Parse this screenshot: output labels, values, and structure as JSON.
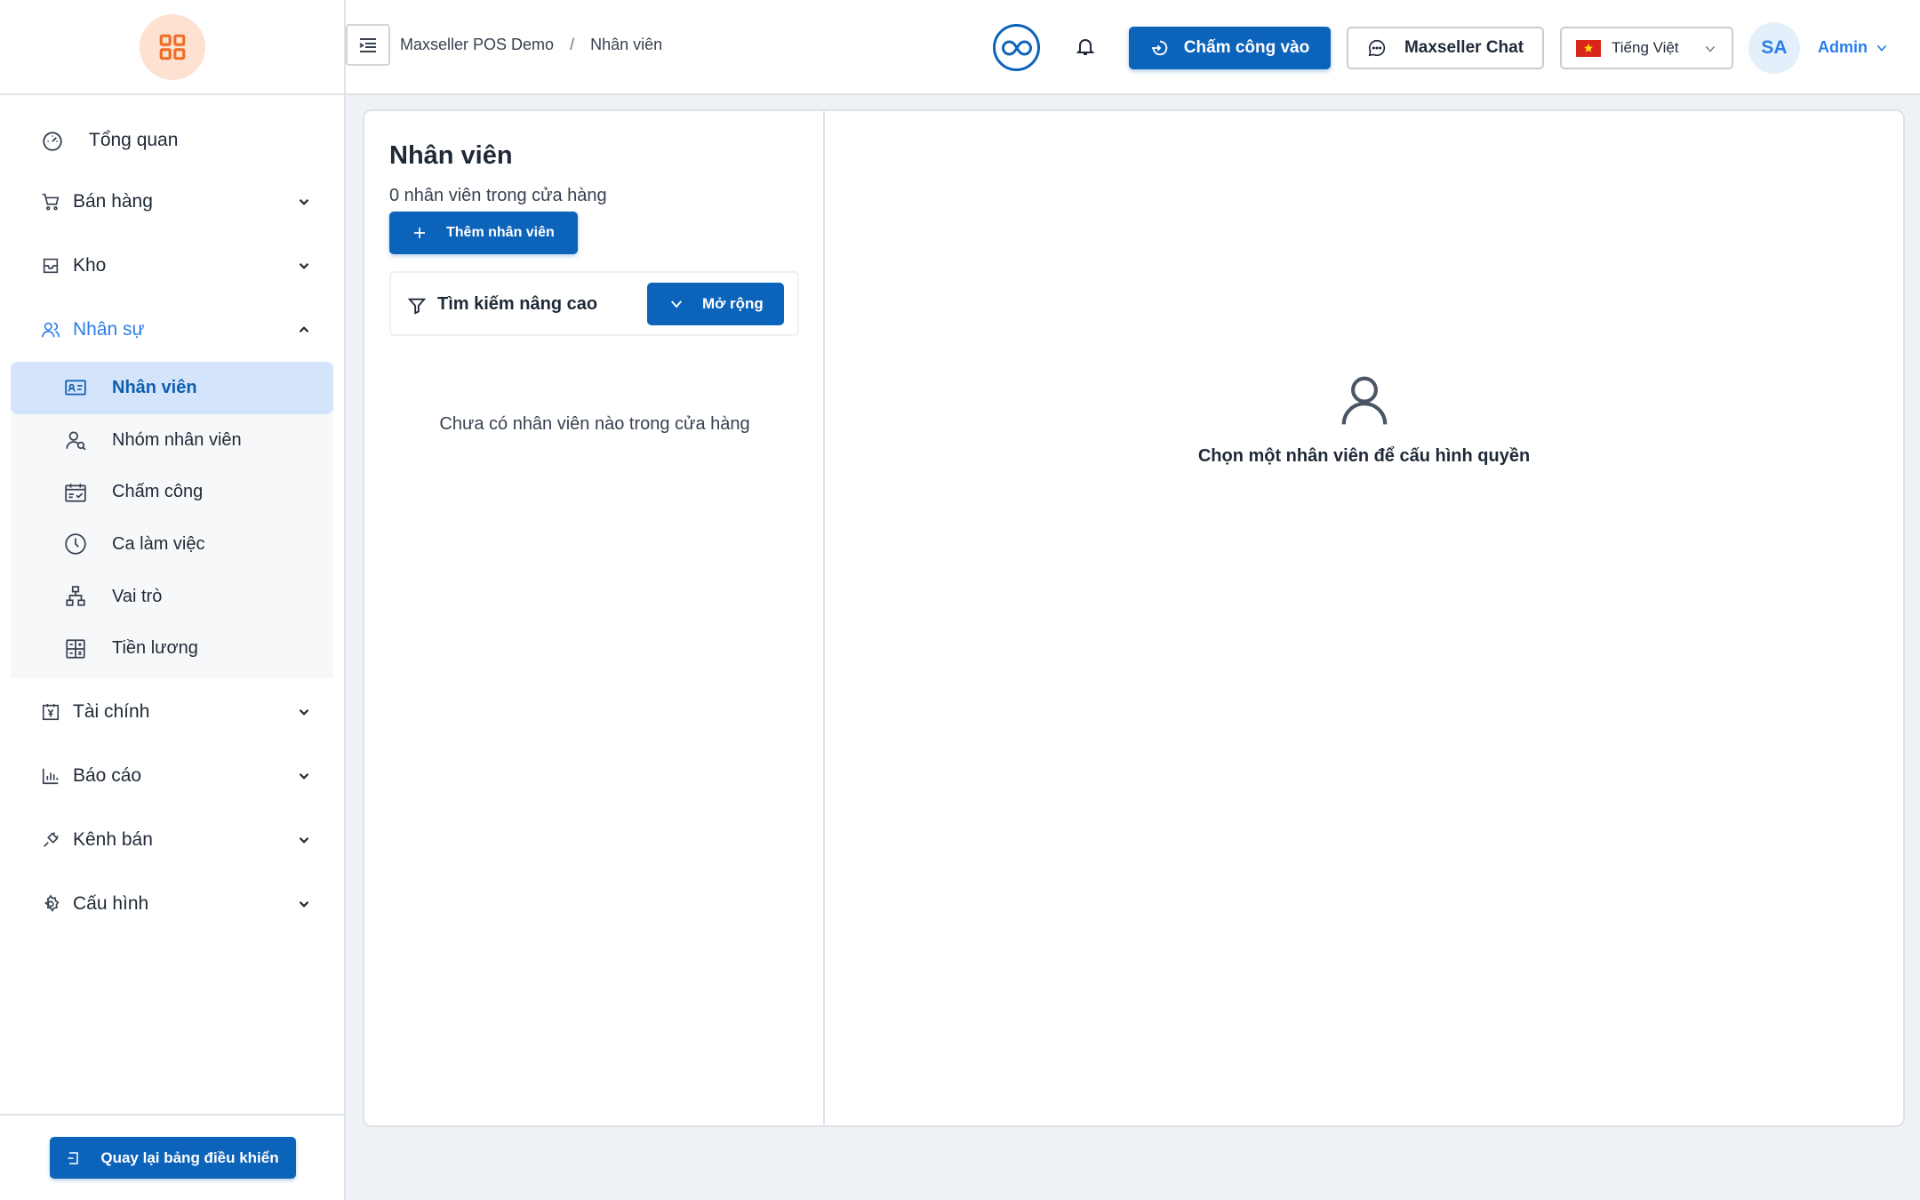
{
  "colors": {
    "primary": "#0c63ba",
    "active_text": "#2b7de9",
    "selected_bg": "#d4e4fb",
    "logo_bg": "#fde1d1",
    "logo_icon": "#f06b23"
  },
  "sidebar": {
    "logo_icon": "grid-icon",
    "items": [
      {
        "label": "Tổng quan",
        "icon": "gauge-icon"
      },
      {
        "label": "Bán hàng",
        "icon": "cart-icon"
      },
      {
        "label": "Kho",
        "icon": "box-icon"
      },
      {
        "label": "Nhân sự",
        "icon": "people-icon",
        "expanded": true,
        "children": [
          {
            "label": "Nhân viên",
            "icon": "id-card-icon",
            "selected": true
          },
          {
            "label": "Nhóm nhân viên",
            "icon": "group-icon"
          },
          {
            "label": "Chấm công",
            "icon": "calendar-check-icon"
          },
          {
            "label": "Ca làm việc",
            "icon": "clock-icon"
          },
          {
            "label": "Vai trò",
            "icon": "hierarchy-icon"
          },
          {
            "label": "Tiền lương",
            "icon": "calculator-icon"
          }
        ]
      },
      {
        "label": "Tài chính",
        "icon": "yen-calendar-icon"
      },
      {
        "label": "Báo cáo",
        "icon": "bar-chart-icon"
      },
      {
        "label": "Kênh bán",
        "icon": "plug-icon"
      },
      {
        "label": "Cấu hình",
        "icon": "gear-icon"
      }
    ],
    "back_button": "Quay lại bảng điều khiển"
  },
  "header": {
    "breadcrumb": [
      "Maxseller POS Demo",
      "Nhân viên"
    ],
    "breadcrumb_separator": "/",
    "clock_in": "Chấm công vào",
    "chat": "Maxseller Chat",
    "language": "Tiếng Việt",
    "avatar_initials": "SA",
    "user_name": "Admin"
  },
  "main": {
    "title": "Nhân viên",
    "subtitle": "0 nhân viên trong cửa hàng",
    "add_button": "Thêm nhân viên",
    "search_label": "Tìm kiếm nâng cao",
    "expand_button": "Mở rộng",
    "empty_list": "Chưa có nhân viên nào trong cửa hàng",
    "placeholder": "Chọn một nhân viên để cấu hình quyền"
  }
}
